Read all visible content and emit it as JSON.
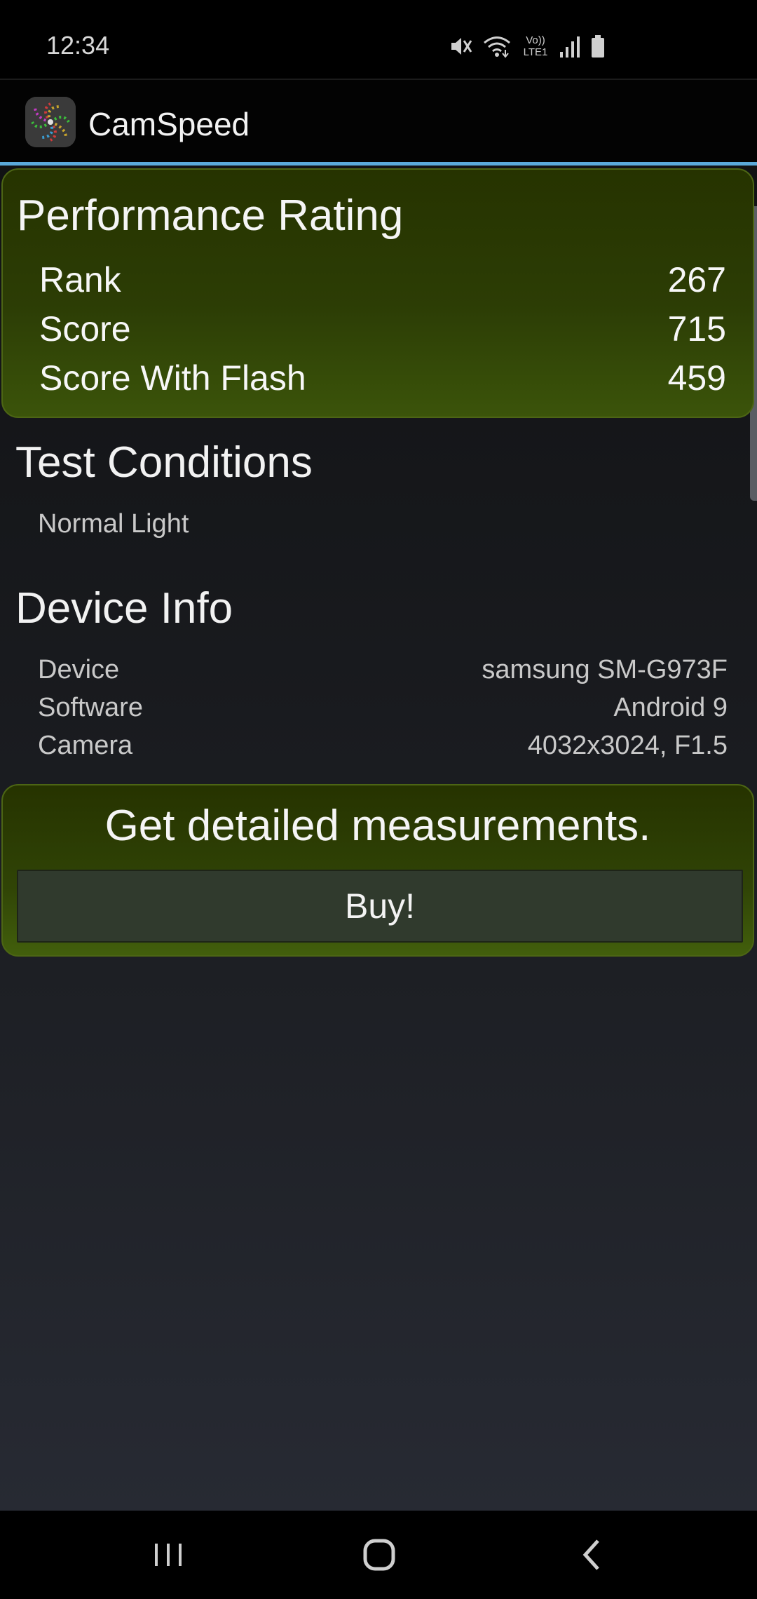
{
  "status_bar": {
    "time": "12:34",
    "network_label": "Vo)) LTE1",
    "icons": [
      "mute-icon",
      "wifi-icon",
      "volte-lte-icon",
      "signal-icon",
      "battery-icon"
    ]
  },
  "app_bar": {
    "title": "CamSpeed",
    "icon": "camspeed-app-icon",
    "accent_color": "#5aa9da"
  },
  "performance": {
    "title": "Performance Rating",
    "rows": [
      {
        "label": "Rank",
        "value": "267"
      },
      {
        "label": "Score",
        "value": "715"
      },
      {
        "label": "Score With Flash",
        "value": "459"
      }
    ],
    "card_color": "#2c3d05"
  },
  "test_conditions": {
    "title": "Test Conditions",
    "value": "Normal Light"
  },
  "device_info": {
    "title": "Device Info",
    "rows": [
      {
        "label": "Device",
        "value": "samsung SM-G973F"
      },
      {
        "label": "Software",
        "value": "Android 9"
      },
      {
        "label": "Camera",
        "value": "4032x3024, F1.5"
      }
    ]
  },
  "promo": {
    "text": "Get detailed measurements.",
    "button_label": "Buy!"
  },
  "nav_bar": {
    "icons": [
      "recent-apps-icon",
      "home-icon",
      "back-icon"
    ]
  }
}
